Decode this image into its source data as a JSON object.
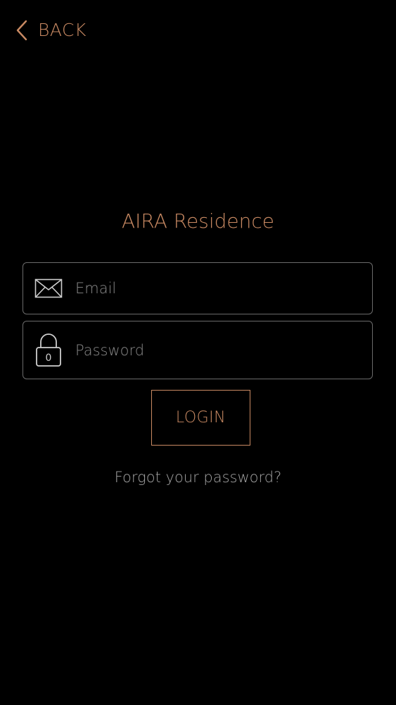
{
  "nav": {
    "back_label": "BACK",
    "back_icon": "chevron-left-icon"
  },
  "app": {
    "title": "AIRA Residence"
  },
  "form": {
    "email": {
      "placeholder": "Email",
      "value": "",
      "icon": "envelope-icon"
    },
    "password": {
      "placeholder": "Password",
      "value": "",
      "icon": "padlock-icon",
      "icon_glyph": "0"
    },
    "login_label": "LOGIN",
    "forgot_label": "Forgot your password?"
  },
  "colors": {
    "background": "#000000",
    "accent": "#c98a63",
    "field_border": "#6b6b6b",
    "placeholder": "#8a8a8a",
    "secondary_text": "#a3a3a3"
  }
}
